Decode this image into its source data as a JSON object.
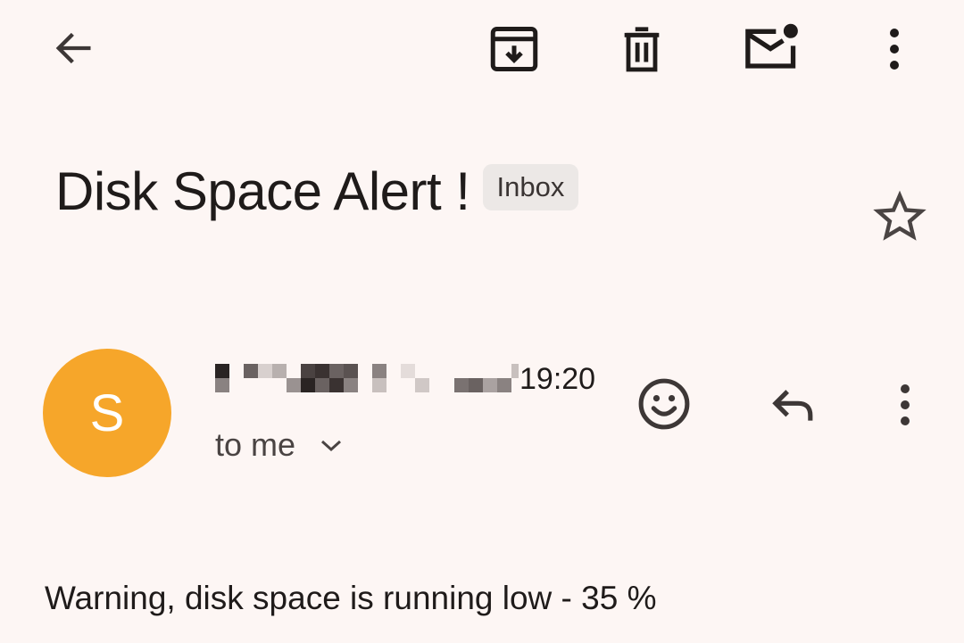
{
  "toolbar": {
    "back_icon": "arrow-back-icon",
    "archive_icon": "archive-icon",
    "delete_icon": "trash-icon",
    "mark_unread_icon": "mail-unread-icon",
    "more_icon": "more-vert-icon"
  },
  "email": {
    "subject": "Disk Space Alert !",
    "label": "Inbox",
    "starred": false,
    "sender_initial": "S",
    "avatar_color": "#f6a62a",
    "time": "19:20",
    "recipient": "to me",
    "body": "Warning, disk space is running low - 35 %"
  },
  "actions": {
    "emoji_icon": "emoji-reaction-icon",
    "reply_icon": "reply-icon",
    "more_icon": "more-vert-icon"
  }
}
